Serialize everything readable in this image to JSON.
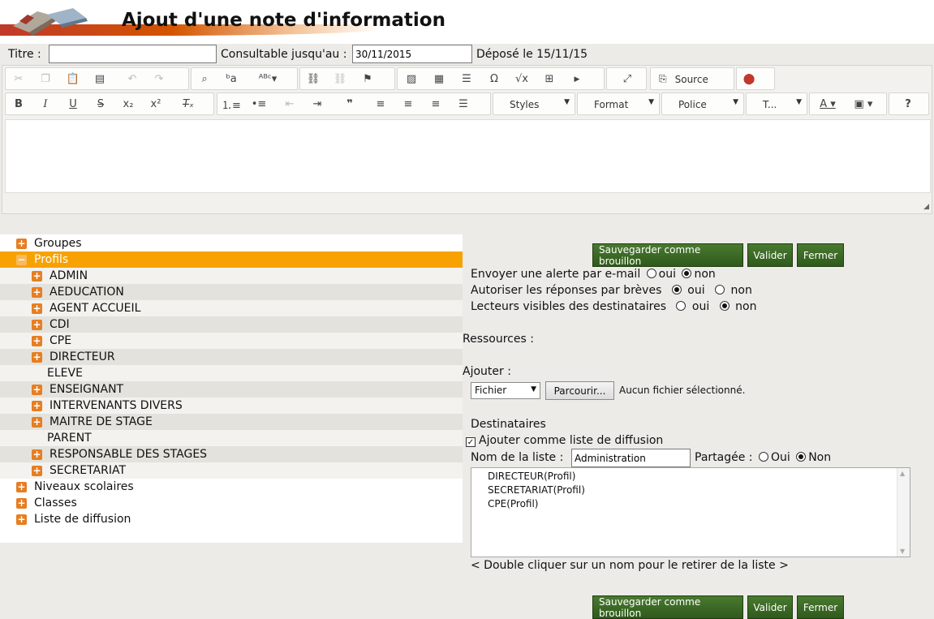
{
  "page": {
    "title": "Ajout d'une note d'information"
  },
  "form": {
    "title_label": "Titre :",
    "title_value": "",
    "until_label": "Consultable jusqu'au :",
    "until_value": "30/11/2015",
    "deposited": "Déposé le 15/11/15"
  },
  "toolbar": {
    "source_label": "Source",
    "styles_label": "Styles",
    "format_label": "Format",
    "font_label": "Police",
    "size_label": "T...",
    "help_label": "?"
  },
  "tree": {
    "groupes": "Groupes",
    "profils": "Profils",
    "profiles": [
      "ADMIN",
      "AEDUCATION",
      "AGENT ACCUEIL",
      "CDI",
      "CPE",
      "DIRECTEUR",
      "ELEVE",
      "ENSEIGNANT",
      "INTERVENANTS DIVERS",
      "MAITRE DE STAGE",
      "PARENT",
      "RESPONSABLE DES STAGES",
      "SECRETARIAT"
    ],
    "niveaux": "Niveaux scolaires",
    "classes": "Classes",
    "listes": "Liste de diffusion"
  },
  "actions": {
    "draft": "Sauvegarder comme brouillon",
    "validate": "Valider",
    "close": "Fermer"
  },
  "options": {
    "email_alert": "Envoyer une alerte par e-mail",
    "replies": "Autoriser les réponses par brèves",
    "visible_readers": "Lecteurs visibles des destinataires",
    "oui": "oui",
    "non": "non"
  },
  "resources": {
    "label": "Ressources :",
    "add_label": "Ajouter :",
    "type_selected": "Fichier",
    "browse": "Parcourir...",
    "no_file": "Aucun fichier sélectionné."
  },
  "recipients": {
    "label": "Destinataires",
    "add_as_list": "Ajouter comme liste de diffusion",
    "list_name_label": "Nom de la liste :",
    "list_name_value": "Administration",
    "shared_label": "Partagée :",
    "oui": "Oui",
    "non": "Non",
    "items": [
      "DIRECTEUR(Profil)",
      "SECRETARIAT(Profil)",
      "CPE(Profil)"
    ],
    "hint": "< Double cliquer sur un nom pour le retirer de la liste >"
  },
  "icons": [
    "cut-icon",
    "copy-icon",
    "paste-icon",
    "paste-text-icon",
    "undo-icon",
    "redo-icon",
    "find-icon",
    "replace-icon",
    "spellcheck-icon",
    "link-icon",
    "unlink-icon",
    "anchor-icon",
    "image-icon",
    "table-icon",
    "hr-icon",
    "omega-icon",
    "sqrt-icon",
    "plus-icon",
    "youtube-icon",
    "maximize-icon",
    "source-icon",
    "map-pin-icon"
  ]
}
